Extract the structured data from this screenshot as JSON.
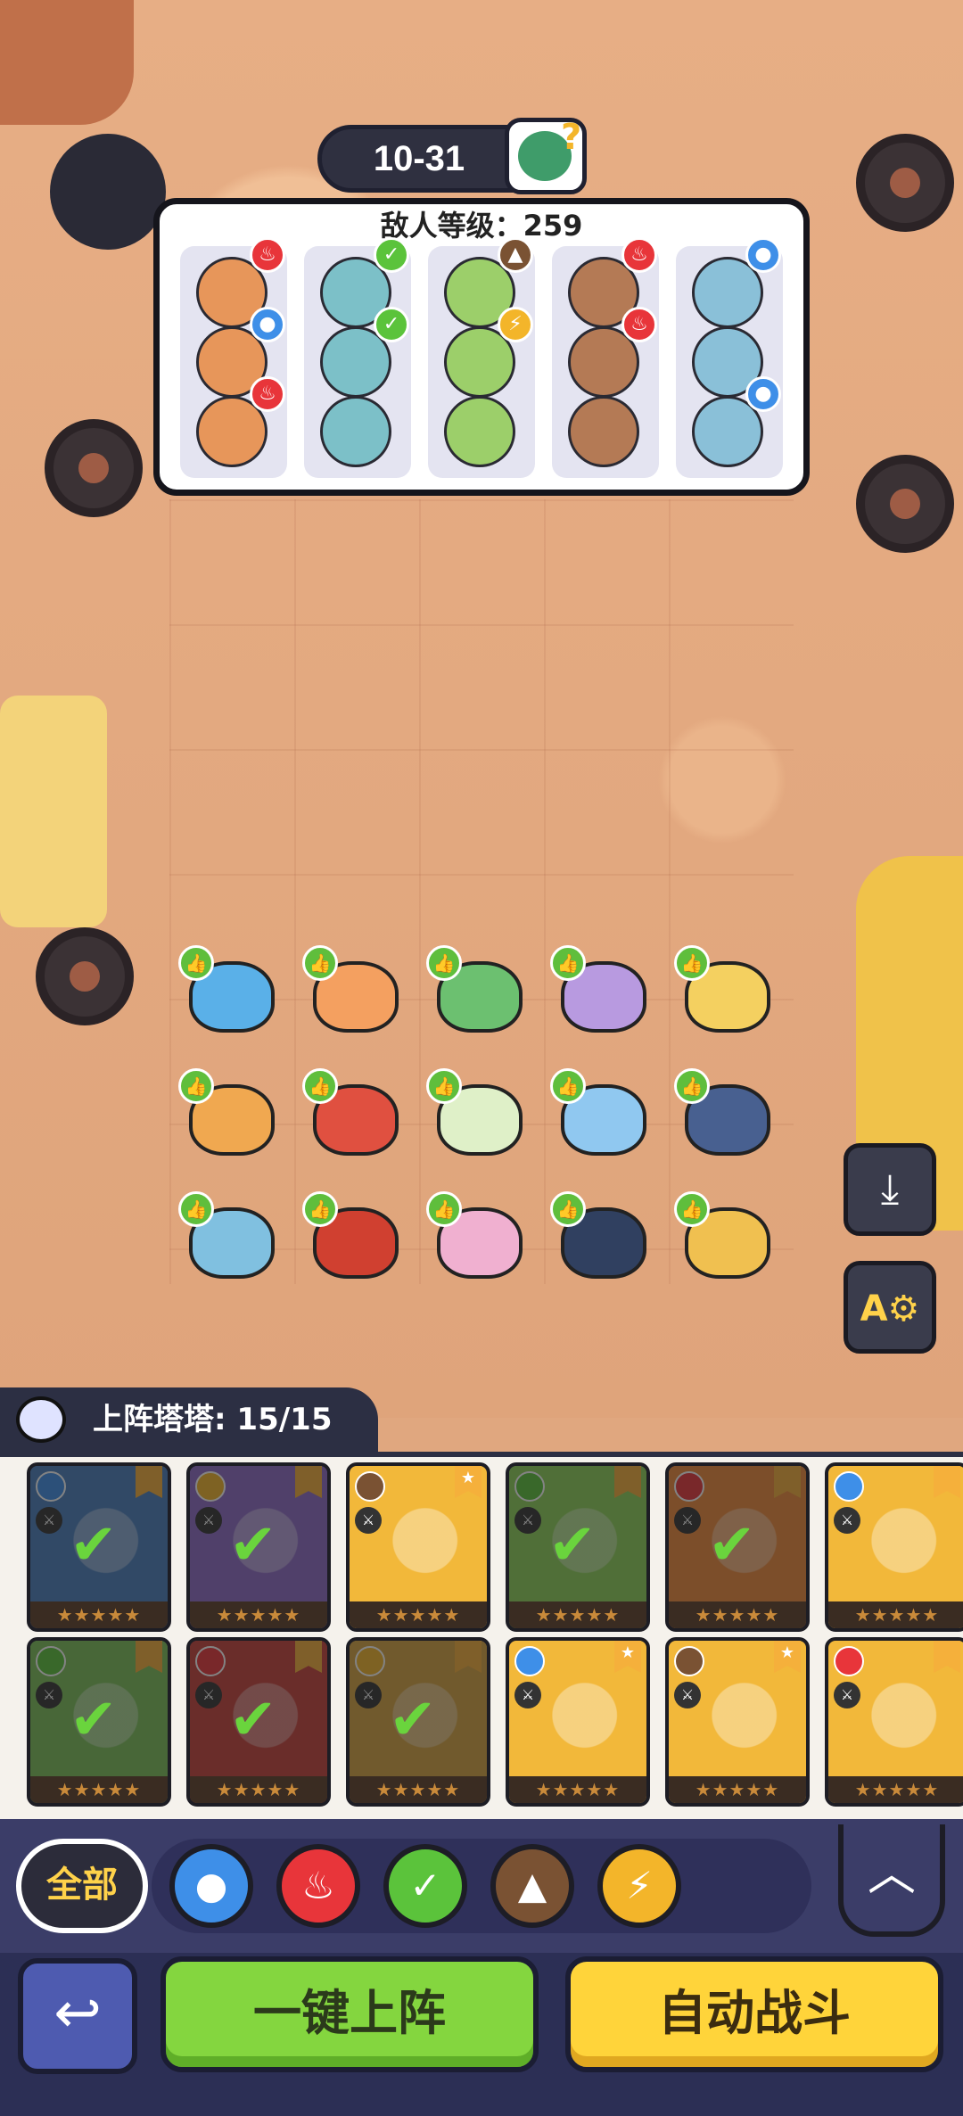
{
  "header": {
    "stage": "10-31",
    "enemy_level_label": "敌人等级：259"
  },
  "enemy_columns": [
    {
      "elements": [
        "fire",
        "water",
        "fire"
      ]
    },
    {
      "elements": [
        "grass",
        "grass",
        ""
      ]
    },
    {
      "elements": [
        "earth",
        "thunder",
        ""
      ]
    },
    {
      "elements": [
        "fire",
        "fire",
        ""
      ]
    },
    {
      "elements": [
        "water",
        "",
        "water"
      ]
    }
  ],
  "element_colors": {
    "fire": "#e8353a",
    "water": "#3e8fe8",
    "grass": "#5bc33b",
    "earth": "#7a5233",
    "thunder": "#f3b52a"
  },
  "units": {
    "rows": [
      [
        "blue-dragon",
        "fire-bunny",
        "leaf-frog",
        "purple-cat",
        "yellow-pup"
      ],
      [
        "antler-deer",
        "red-dragon",
        "green-sprout",
        "ice-serpent",
        "blue-shark"
      ],
      [
        "shell-crab",
        "red-tiger",
        "pink-mantis",
        "penguin",
        "lion"
      ]
    ]
  },
  "side_buttons": {
    "save_icon": "download-icon",
    "auto_settings_icon": "auto-settings-icon"
  },
  "tray": {
    "deploy_count": "上阵塔塔: 15/15",
    "cards": [
      {
        "element": "water",
        "color": "#4a7fbf",
        "selected": true,
        "flag": ""
      },
      {
        "element": "thunder",
        "color": "#8e6bc8",
        "selected": true,
        "flag": ""
      },
      {
        "element": "earth",
        "color": "#f2b83a",
        "selected": false,
        "flag": "★"
      },
      {
        "element": "grass",
        "color": "#8fd35a",
        "selected": true,
        "flag": ""
      },
      {
        "element": "fire",
        "color": "#f08a3a",
        "selected": true,
        "flag": ""
      },
      {
        "element": "water",
        "color": "#f2b83a",
        "selected": false,
        "flag": ""
      },
      {
        "element": "grass",
        "color": "#7cc25a",
        "selected": true,
        "flag": ""
      },
      {
        "element": "fire",
        "color": "#c8403a",
        "selected": true,
        "flag": ""
      },
      {
        "element": "thunder",
        "color": "#d8a440",
        "selected": true,
        "flag": ""
      },
      {
        "element": "water",
        "color": "#f2b83a",
        "selected": false,
        "flag": "★"
      },
      {
        "element": "earth",
        "color": "#f2b83a",
        "selected": false,
        "flag": "★"
      },
      {
        "element": "fire",
        "color": "#f2b83a",
        "selected": false,
        "flag": ""
      }
    ]
  },
  "filter": {
    "all_label": "全部",
    "elements": [
      "water",
      "fire",
      "grass",
      "earth",
      "thunder"
    ]
  },
  "actions": {
    "deploy_label": "一键上阵",
    "auto_battle_label": "自动战斗"
  }
}
